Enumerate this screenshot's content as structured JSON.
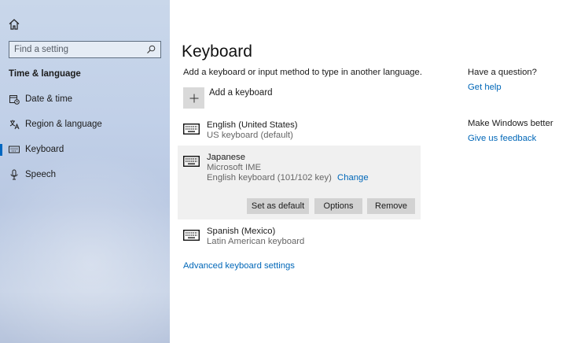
{
  "sidebar": {
    "search_placeholder": "Find a setting",
    "section_title": "Time & language",
    "items": [
      {
        "label": "Date & time"
      },
      {
        "label": "Region & language"
      },
      {
        "label": "Keyboard"
      },
      {
        "label": "Speech"
      }
    ],
    "active_index": 2
  },
  "main": {
    "title": "Keyboard",
    "description": "Add a keyboard or input method to type in another language.",
    "add_keyboard_label": "Add a keyboard",
    "languages": [
      {
        "name": "English (United States)",
        "line1": "US keyboard (default)"
      },
      {
        "name": "Japanese",
        "line1": "Microsoft IME",
        "line2": "English keyboard (101/102 key)",
        "change_label": "Change"
      },
      {
        "name": "Spanish (Mexico)",
        "line1": "Latin American keyboard"
      }
    ],
    "buttons": {
      "set_default": "Set as default",
      "options": "Options",
      "remove": "Remove"
    },
    "advanced_link": "Advanced keyboard settings"
  },
  "aside": {
    "question_title": "Have a question?",
    "get_help": "Get help",
    "better_title": "Make Windows better",
    "feedback": "Give us feedback"
  },
  "colors": {
    "accent": "#0067b8",
    "selected_bg": "#f0f0f0",
    "button_bg": "#d2d2d2"
  }
}
